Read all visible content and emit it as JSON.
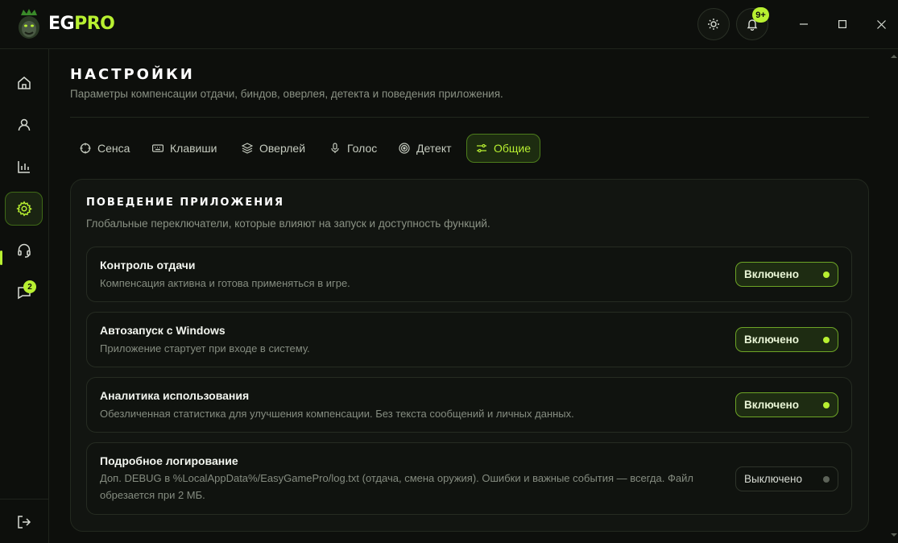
{
  "app": {
    "logo_part1": "EG",
    "logo_part2": "PRO",
    "notifications_badge": "9+"
  },
  "sidebar": {
    "items": [
      {
        "icon": "home-icon"
      },
      {
        "icon": "user-icon"
      },
      {
        "icon": "chart-icon"
      },
      {
        "icon": "gear-icon",
        "active": true
      },
      {
        "icon": "headset-icon"
      },
      {
        "icon": "chat-icon",
        "badge": "2"
      }
    ],
    "logout_icon": "logout-icon"
  },
  "page": {
    "title": "НАСТРОЙКИ",
    "subtitle": "Параметры компенсации отдачи, биндов, оверлея, детекта и поведения приложения."
  },
  "tabs": [
    {
      "label": "Сенса",
      "icon": "crosshair-icon"
    },
    {
      "label": "Клавиши",
      "icon": "keyboard-icon"
    },
    {
      "label": "Оверлей",
      "icon": "layers-icon"
    },
    {
      "label": "Голос",
      "icon": "mic-icon"
    },
    {
      "label": "Детект",
      "icon": "target-icon"
    },
    {
      "label": "Общие",
      "icon": "sliders-icon",
      "active": true
    }
  ],
  "section": {
    "title": "ПОВЕДЕНИЕ ПРИЛОЖЕНИЯ",
    "subtitle": "Глобальные переключатели, которые влияют на запуск и доступность функций."
  },
  "settings": [
    {
      "title": "Контроль отдачи",
      "desc": "Компенсация активна и готова применяться в игре.",
      "state": "Включено",
      "on": true
    },
    {
      "title": "Автозапуск с Windows",
      "desc": "Приложение стартует при входе в систему.",
      "state": "Включено",
      "on": true
    },
    {
      "title": "Аналитика использования",
      "desc": "Обезличенная статистика для улучшения компенсации. Без текста сообщений и личных данных.",
      "state": "Включено",
      "on": true
    },
    {
      "title": "Подробное логирование",
      "desc": "Доп. DEBUG в %LocalAppData%/EasyGamePro/log.txt (отдача, смена оружия). Ошибки и важные события — всегда. Файл обрезается при 2 МБ.",
      "state": "Выключено",
      "on": false
    }
  ],
  "colors": {
    "accent": "#b8f031",
    "background": "#0d0f0c",
    "card": "#121511"
  }
}
